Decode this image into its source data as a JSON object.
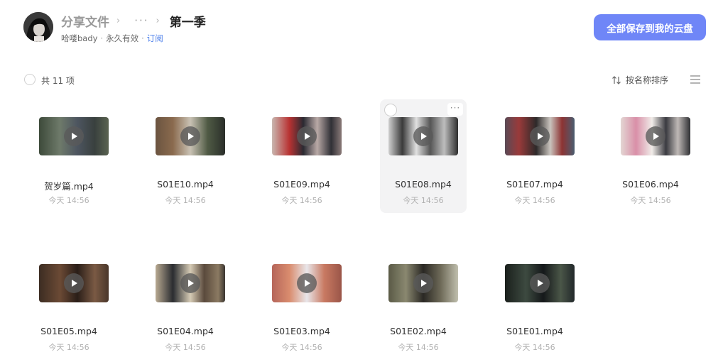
{
  "header": {
    "breadcrumb": {
      "root": "分享文件",
      "sep": "›",
      "ellipsis": "···",
      "current": "第一季"
    },
    "meta": {
      "user": "哈喽bady",
      "validity": "永久有效",
      "subscribe": "订阅",
      "dot": "·"
    },
    "save_button": "全部保存到我的云盘"
  },
  "toolbar": {
    "count_label": "共 11 项",
    "sort_label": "按名称排序"
  },
  "files": [
    {
      "name": "贺岁篇.mp4",
      "time": "今天 14:56"
    },
    {
      "name": "S01E10.mp4",
      "time": "今天 14:56"
    },
    {
      "name": "S01E09.mp4",
      "time": "今天 14:56"
    },
    {
      "name": "S01E08.mp4",
      "time": "今天 14:56"
    },
    {
      "name": "S01E07.mp4",
      "time": "今天 14:56"
    },
    {
      "name": "S01E06.mp4",
      "time": "今天 14:56"
    },
    {
      "name": "S01E05.mp4",
      "time": "今天 14:56"
    },
    {
      "name": "S01E04.mp4",
      "time": "今天 14:56"
    },
    {
      "name": "S01E03.mp4",
      "time": "今天 14:56"
    },
    {
      "name": "S01E02.mp4",
      "time": "今天 14:56"
    },
    {
      "name": "S01E01.mp4",
      "time": "今天 14:56"
    }
  ],
  "tile_more": "···",
  "colors": {
    "accent": "#6f86f7",
    "link": "#4a7eea",
    "hover_bg": "#f3f3f4"
  },
  "icons": [
    "avatar",
    "chevron-right-icon",
    "more-icon",
    "checkbox-icon",
    "sort-icon",
    "list-view-icon",
    "play-icon"
  ]
}
